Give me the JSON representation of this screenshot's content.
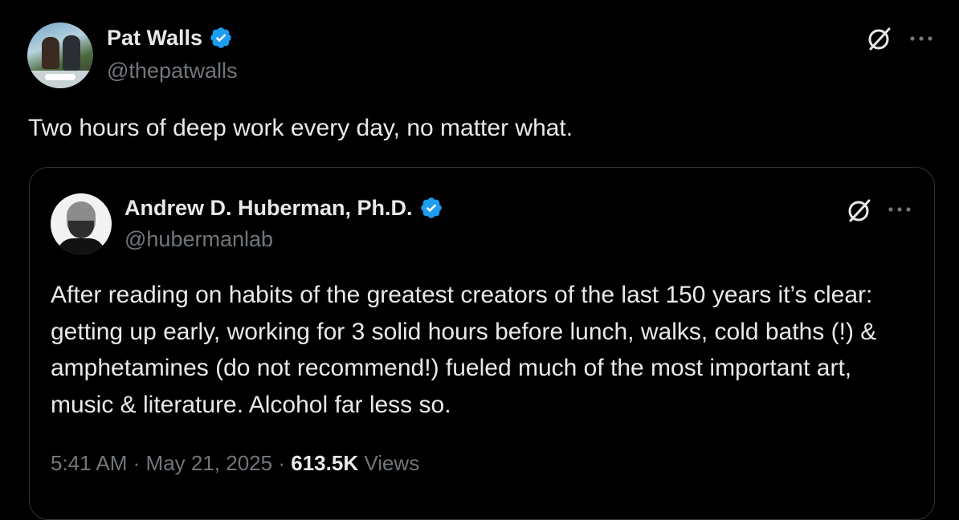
{
  "main_tweet": {
    "author": {
      "name": "Pat Walls",
      "handle": "@thepatwalls",
      "verified": true
    },
    "text": "Two hours of deep work every day, no matter what.",
    "icons": [
      "grok-icon",
      "more-icon"
    ]
  },
  "quoted_tweet": {
    "author": {
      "name": "Andrew D. Huberman, Ph.D.",
      "handle": "@hubermanlab",
      "verified": true
    },
    "text": "After reading on habits of the greatest creators of the last 150 years it’s clear: getting up early, working for 3 solid hours before lunch, walks, cold baths (!) & amphetamines (do not recommend!) fueled much of the most important art, music & literature. Alcohol far less so.",
    "time": "5:41 AM",
    "separator": "·",
    "date": "May 21, 2025",
    "views_count": "613.5K",
    "views_label": "Views"
  },
  "colors": {
    "background": "#000000",
    "primary_text": "#e7e9ea",
    "secondary_text": "#71767b",
    "verified_blue": "#1d9bf0",
    "border": "#2f3336"
  }
}
